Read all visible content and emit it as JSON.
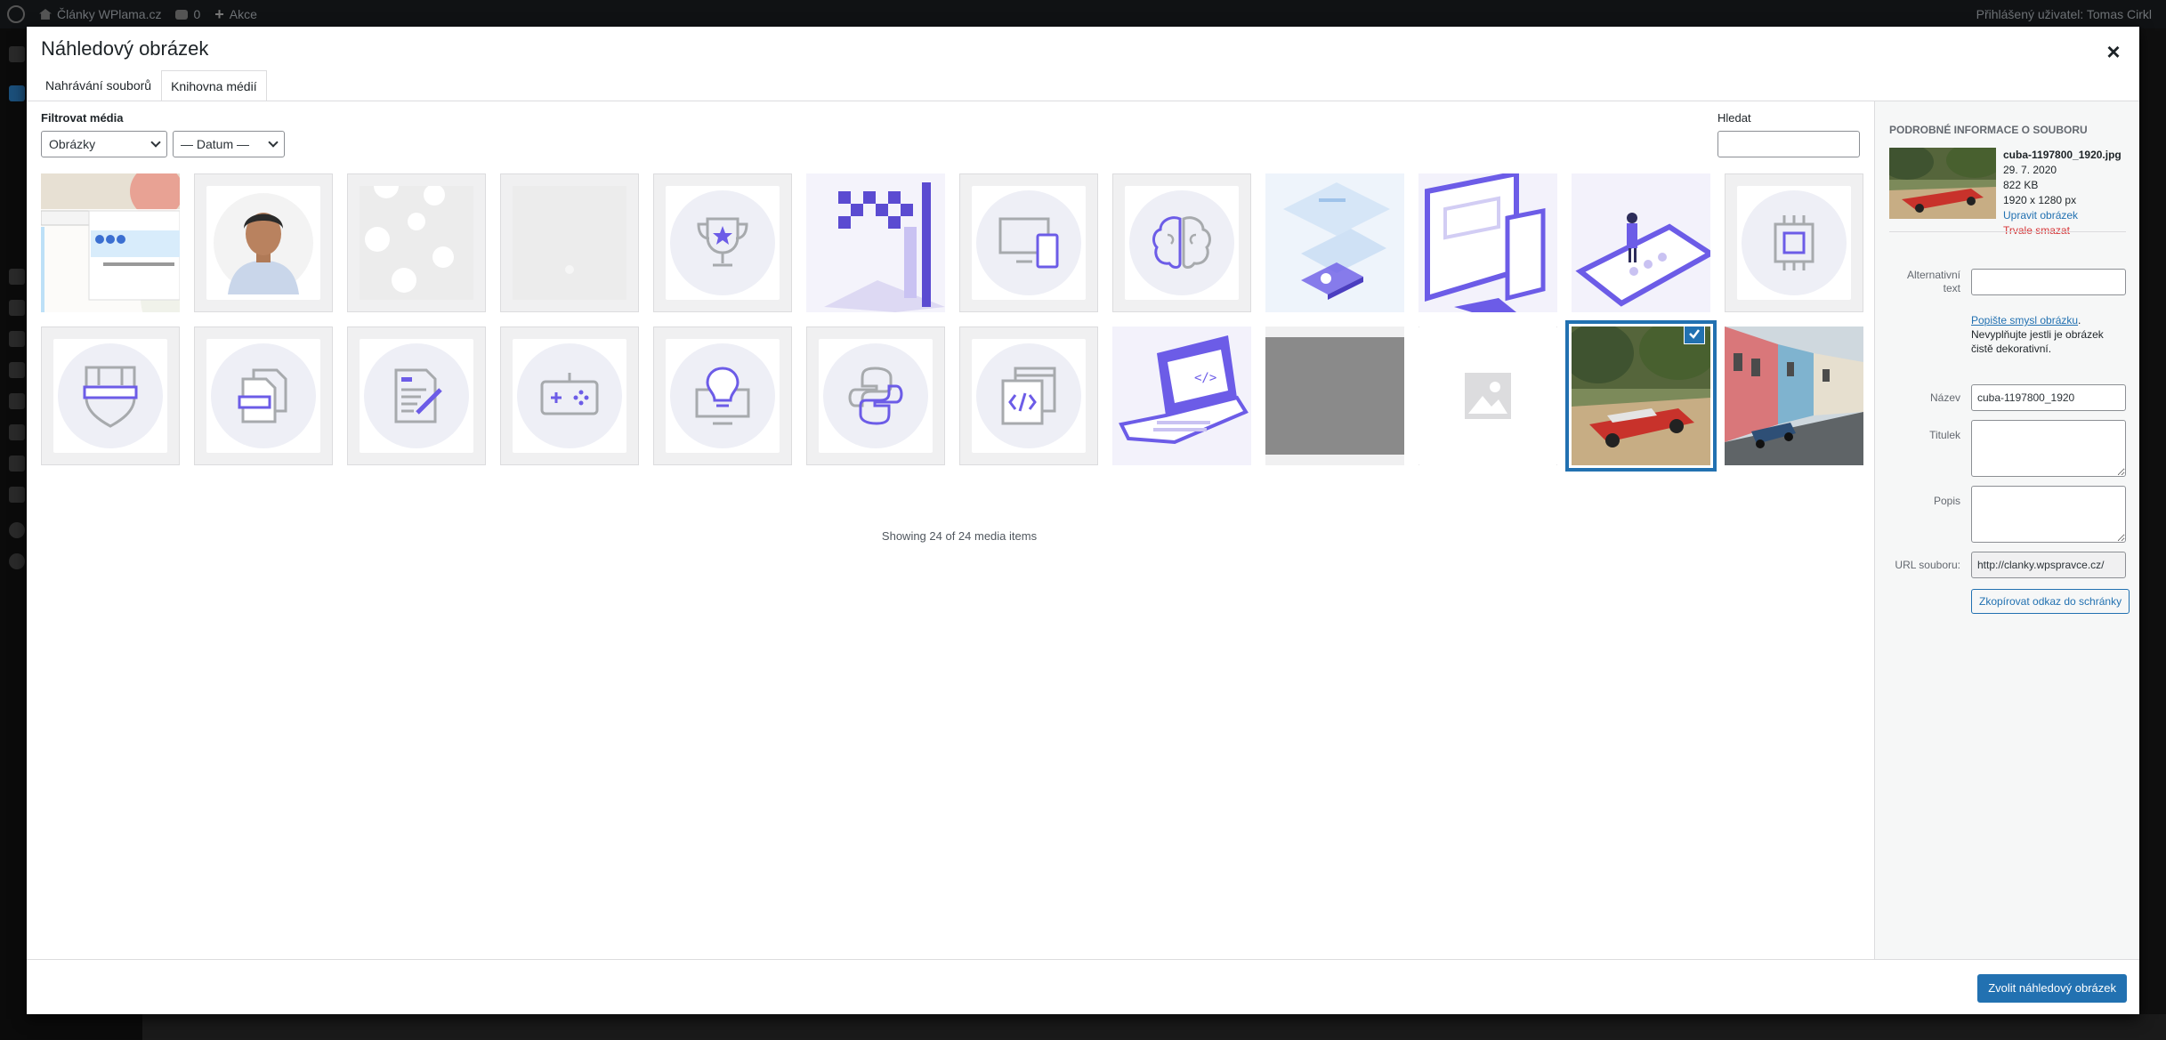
{
  "adminbar": {
    "site_name": "Články WPlama.cz",
    "comments_count": "0",
    "new_label": "Akce",
    "user_label": "Přihlášený uživatel: Tomas Cirkl"
  },
  "modal": {
    "title": "Náhledový obrázek",
    "close_icon": "×",
    "tabs": [
      {
        "label": "Nahrávání souborů"
      },
      {
        "label": "Knihovna médií"
      }
    ]
  },
  "toolbar": {
    "filter_label": "Filtrovat média",
    "type_filter": "Obrázky",
    "date_filter": "— Datum —",
    "search_label": "Hledat",
    "search_value": ""
  },
  "grid": {
    "showing_text": "Showing 24 of 24 media items",
    "items": [
      {
        "kind": "screenshot-collage"
      },
      {
        "kind": "portrait"
      },
      {
        "kind": "light-dots"
      },
      {
        "kind": "blank-light"
      },
      {
        "kind": "trophy-icon"
      },
      {
        "kind": "isometric-flag"
      },
      {
        "kind": "devices-icon"
      },
      {
        "kind": "brain-icon"
      },
      {
        "kind": "isometric-phones"
      },
      {
        "kind": "isometric-monitor"
      },
      {
        "kind": "person-on-phone"
      },
      {
        "kind": "chip-icon"
      },
      {
        "kind": "shield-icon"
      },
      {
        "kind": "documents-icon"
      },
      {
        "kind": "edit-document-icon"
      },
      {
        "kind": "gamepad-icon"
      },
      {
        "kind": "lightbulb-icon"
      },
      {
        "kind": "python-icon"
      },
      {
        "kind": "code-window-icon"
      },
      {
        "kind": "isometric-laptop"
      },
      {
        "kind": "gray-image"
      },
      {
        "kind": "placeholder-image"
      },
      {
        "kind": "cuba-red-car"
      },
      {
        "kind": "havana-street"
      }
    ],
    "selected_index": 22
  },
  "details": {
    "heading": "Podrobné informace o souboru",
    "filename": "cuba-1197800_1920.jpg",
    "date": "29. 7. 2020",
    "filesize": "822 KB",
    "dimensions": "1920 x 1280 px",
    "edit_link": "Upravit obrázek",
    "delete_link": "Trvale smazat",
    "alt_label": "Alternativní text",
    "alt_value": "",
    "alt_help_link": "Popište smysl obrázku",
    "alt_help_dot": ".",
    "alt_help_text": "Nevyplňujte jestli je obrázek čistě dekorativní.",
    "name_label": "Název",
    "name_value": "cuba-1197800_1920",
    "caption_label": "Titulek",
    "caption_value": "",
    "description_label": "Popis",
    "description_value": "",
    "url_label": "URL souboru:",
    "url_value": "http://clanky.wpspravce.cz/",
    "copy_button": "Zkopírovat odkaz do schránky"
  },
  "footer": {
    "primary_button": "Zvolit náhledový obrázek"
  },
  "colors": {
    "accent": "#2271b1",
    "icon_purple": "#6c5ce7",
    "icon_gray": "#a7aaad",
    "danger": "#d63638"
  }
}
